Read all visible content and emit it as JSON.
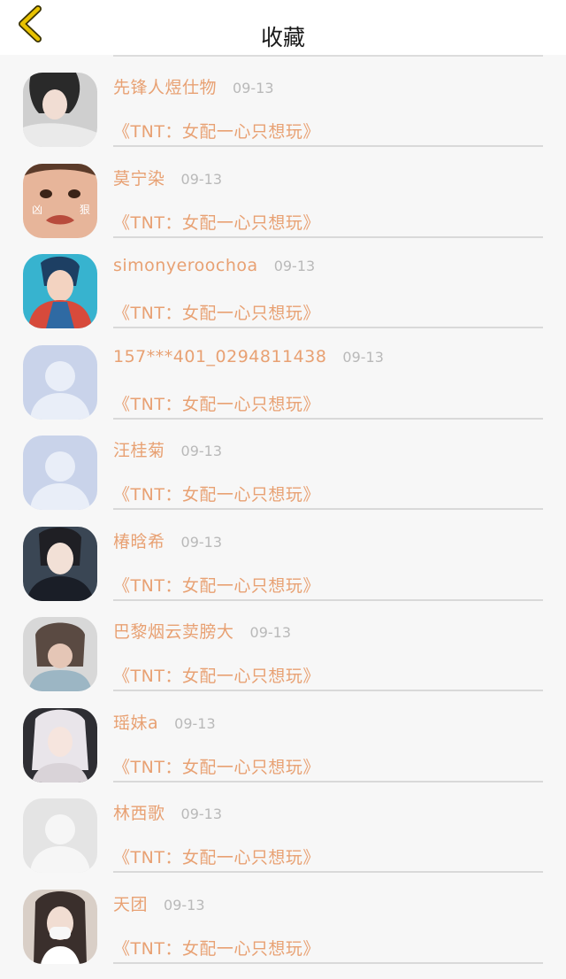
{
  "header": {
    "title": "收藏",
    "back_icon": "chevron-left-icon",
    "back_color": "#e0b800"
  },
  "colors": {
    "accent": "#e8a173",
    "time": "#b9b9b9",
    "background": "#f7f7f7"
  },
  "items": [
    {
      "name": "先锋人煜仕物",
      "time": "09-13",
      "book": "《TNT：女配一心只想玩》",
      "avatar": "photo"
    },
    {
      "name": "莫宁染",
      "time": "09-13",
      "book": "《TNT：女配一心只想玩》",
      "avatar": "child-photo",
      "avatar_text": [
        "凶",
        "狠"
      ]
    },
    {
      "name": "simonyeroochoa",
      "time": "09-13",
      "book": "《TNT：女配一心只想玩》",
      "avatar": "anime"
    },
    {
      "name": "157***401_0294811438",
      "time": "09-13",
      "book": "《TNT：女配一心只想玩》",
      "avatar": "default-blue"
    },
    {
      "name": "汪桂菊",
      "time": "09-13",
      "book": "《TNT：女配一心只想玩》",
      "avatar": "default-blue"
    },
    {
      "name": "椿晗希",
      "time": "09-13",
      "book": "《TNT：女配一心只想玩》",
      "avatar": "photo-dark"
    },
    {
      "name": "巴黎烟云荬膀大",
      "time": "09-13",
      "book": "《TNT：女配一心只想玩》",
      "avatar": "photo-gray"
    },
    {
      "name": "瑶妹a",
      "time": "09-13",
      "book": "《TNT：女配一心只想玩》",
      "avatar": "photo-light"
    },
    {
      "name": "林西歌",
      "time": "09-13",
      "book": "《TNT：女配一心只想玩》",
      "avatar": "default-gray"
    },
    {
      "name": "天团",
      "time": "09-13",
      "book": "《TNT：女配一心只想玩》",
      "avatar": "illustration"
    }
  ]
}
